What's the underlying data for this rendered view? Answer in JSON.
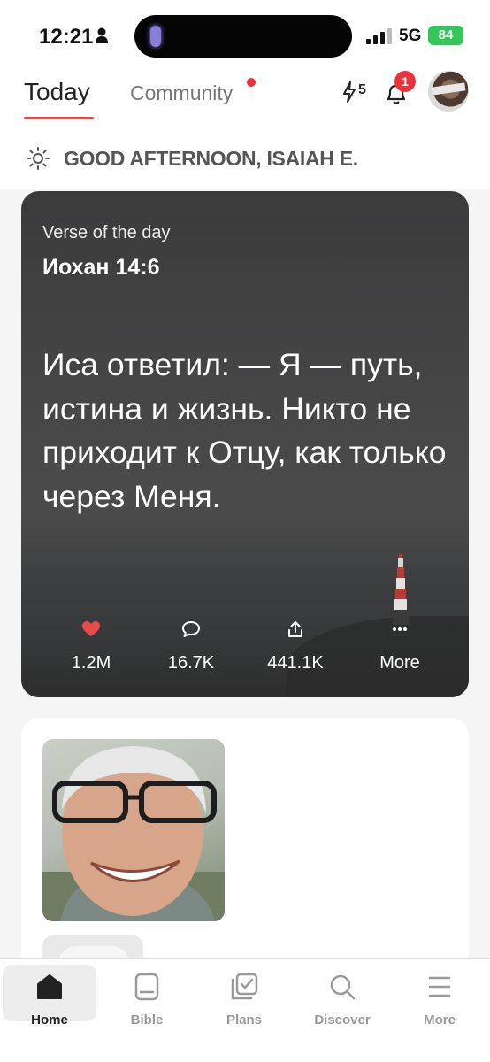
{
  "status_bar": {
    "time": "12:21",
    "network": "5G",
    "battery": "84"
  },
  "header": {
    "tabs": [
      {
        "label": "Today",
        "active": true
      },
      {
        "label": "Community",
        "active": false,
        "has_dot": true
      }
    ],
    "streak_count": "5",
    "notification_badge": "1"
  },
  "greeting": "GOOD AFTERNOON, ISAIAH E.",
  "verse_card": {
    "label": "Verse of the day",
    "reference": "Иохан 14:6",
    "text": "Иса ответил: — Я — путь, истина и жизнь. Никто не приходит к Отцу, как только через Меня.",
    "actions": [
      {
        "icon": "heart-icon",
        "count": "1.2M"
      },
      {
        "icon": "comment-icon",
        "count": "16.7K"
      },
      {
        "icon": "share-icon",
        "count": "441.1K"
      },
      {
        "icon": "more-dots-icon",
        "count": "More"
      }
    ]
  },
  "tabbar": {
    "items": [
      {
        "label": "Home",
        "icon": "home-icon",
        "active": true
      },
      {
        "label": "Bible",
        "icon": "bible-icon",
        "active": false
      },
      {
        "label": "Plans",
        "icon": "plans-icon",
        "active": false
      },
      {
        "label": "Discover",
        "icon": "search-icon",
        "active": false
      },
      {
        "label": "More",
        "icon": "menu-icon",
        "active": false
      }
    ]
  },
  "colors": {
    "accent": "#e84a4a",
    "badge": "#e8323c",
    "battery": "#34c759"
  }
}
